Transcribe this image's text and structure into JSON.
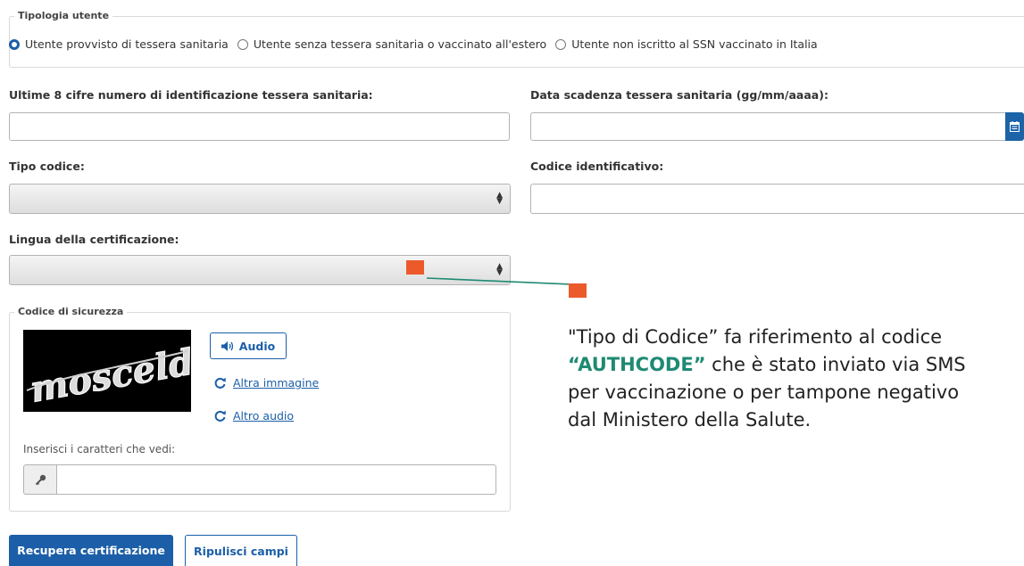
{
  "user_type": {
    "legend": "Tipologia utente",
    "options": [
      {
        "label": "Utente provvisto di tessera sanitaria",
        "selected": true
      },
      {
        "label": "Utente senza tessera sanitaria o vaccinato all'estero",
        "selected": false
      },
      {
        "label": "Utente non iscritto al SSN vaccinato in Italia",
        "selected": false
      }
    ]
  },
  "form": {
    "card_digits_label": "Ultime 8 cifre numero di identificazione tessera sanitaria:",
    "card_digits_value": "",
    "expiry_label": "Data scadenza tessera sanitaria (gg/mm/aaaa):",
    "expiry_value": "",
    "code_type_label": "Tipo codice:",
    "code_type_value": "",
    "code_id_label": "Codice identificativo:",
    "code_id_value": "",
    "language_label": "Lingua della certificazione:",
    "language_value": ""
  },
  "captcha": {
    "legend": "Codice di sicurezza",
    "image_text": "mosceldo",
    "audio_label": "Audio",
    "other_image_label": "Altra immagine",
    "other_audio_label": "Altro audio",
    "input_label": "Inserisci i caratteri che vedi:",
    "input_value": ""
  },
  "buttons": {
    "submit_label": "Recupera certificazione",
    "clear_label": "Ripulisci campi"
  },
  "annotation": {
    "line1": "\"Tipo di Codice” fa riferimento al codice",
    "highlight": "“AUTHCODE”",
    "line2_rest": " che è stato inviato via SMS",
    "line3": "per vaccinazione o per tampone negativo",
    "line4": "dal Ministero della Salute."
  },
  "colors": {
    "accent": "#1c5fa8",
    "marker": "#ec5a2b",
    "connector": "#1e8a73",
    "highlight": "#1e8a73"
  }
}
